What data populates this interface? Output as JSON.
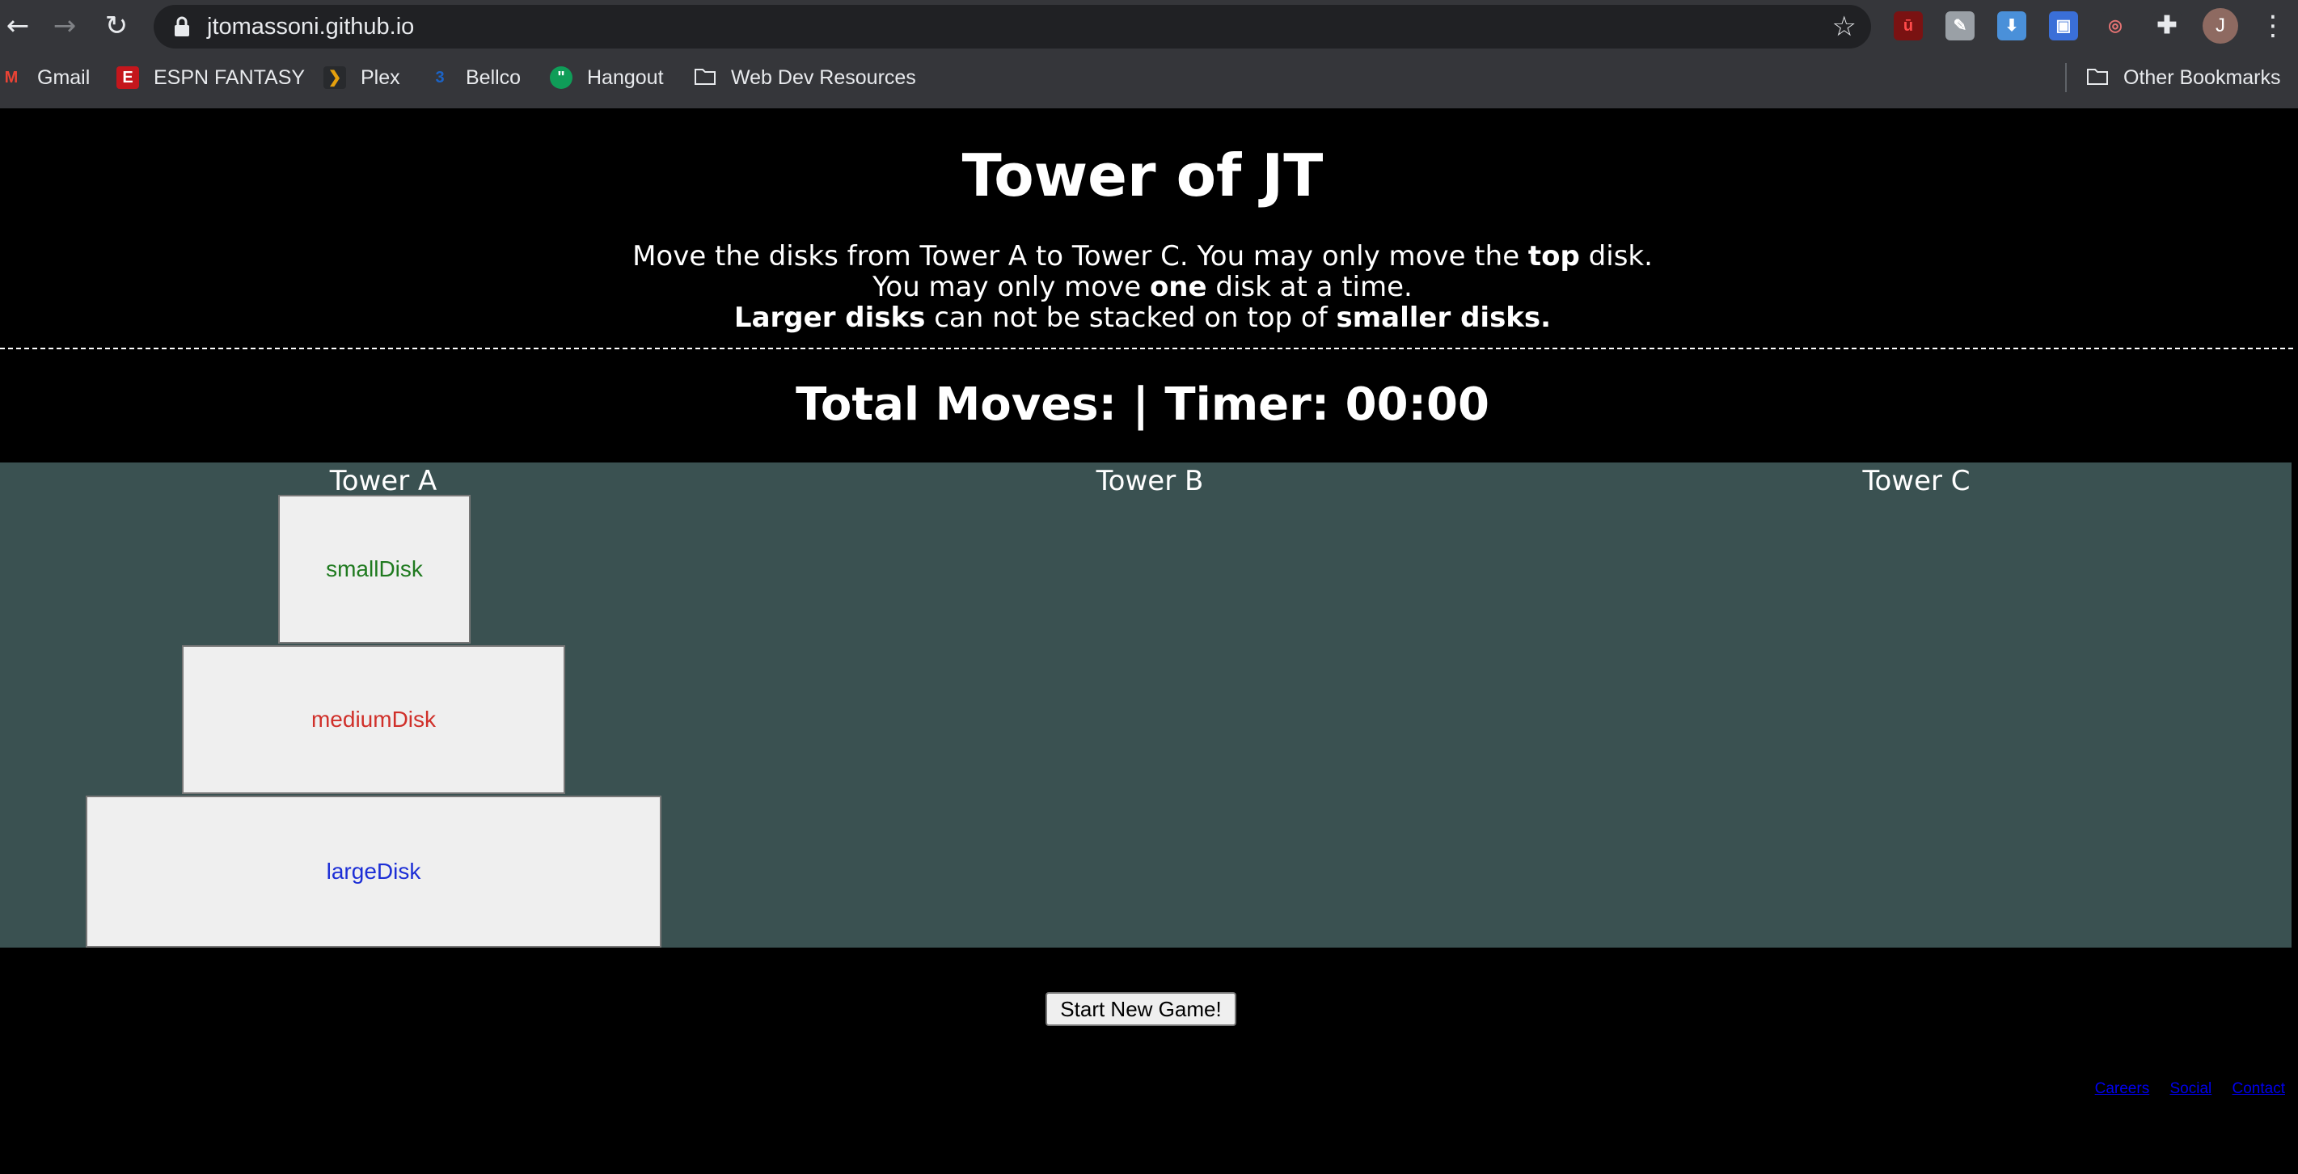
{
  "browser": {
    "url": "jtomassoni.github.io",
    "bookmarks": [
      {
        "label": "Gmail",
        "icon": "gmail-icon"
      },
      {
        "label": "ESPN FANTASY",
        "icon": "espn-icon"
      },
      {
        "label": "Plex",
        "icon": "plex-icon"
      },
      {
        "label": "Bellco",
        "icon": "bellco-icon"
      },
      {
        "label": "Hangout",
        "icon": "hangouts-icon"
      },
      {
        "label": "Web Dev Resources",
        "icon": "folder-icon"
      }
    ],
    "other_bookmarks": "Other Bookmarks",
    "avatar_initial": "J"
  },
  "game": {
    "title": "Tower of JT",
    "rules": {
      "l1_a": "Move the disks from Tower A to Tower C. You may only move the ",
      "l1_b": "top",
      "l1_c": " disk.",
      "l2_a": "You may only move ",
      "l2_b": "one",
      "l2_c": " disk at a time.",
      "l3_a": "Larger disks",
      "l3_b": " can not be stacked on top of ",
      "l3_c": "smaller disks."
    },
    "stats_text": "Total Moves: | Timer: 00:00",
    "towers": [
      "Tower A",
      "Tower B",
      "Tower C"
    ],
    "disks": [
      {
        "label": "smallDisk",
        "color": "#1f7a1f"
      },
      {
        "label": "mediumDisk",
        "color": "#d0302a"
      },
      {
        "label": "largeDisk",
        "color": "#1d2fd6"
      }
    ],
    "new_game_button": "Start New Game!"
  },
  "footer": {
    "links": [
      "Careers",
      "Social",
      "Contact"
    ]
  },
  "colors": {
    "page_background": "#000000",
    "board_background": "#3a5151",
    "disk_background": "#efefef"
  }
}
